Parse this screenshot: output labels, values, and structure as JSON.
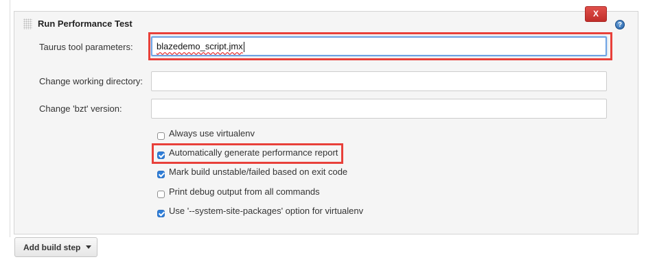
{
  "section": {
    "title": "Run Performance Test",
    "delete_label": "X",
    "help_label": "?"
  },
  "fields": [
    {
      "label": "Taurus tool parameters:",
      "value": "blazedemo_script.jmx"
    },
    {
      "label": "Change working directory:",
      "value": ""
    },
    {
      "label": "Change 'bzt' version:",
      "value": ""
    }
  ],
  "options": [
    {
      "label": "Always use virtualenv",
      "checked": false
    },
    {
      "label": "Automatically generate performance report",
      "checked": true
    },
    {
      "label": "Mark build unstable/failed based on exit code",
      "checked": true
    },
    {
      "label": "Print debug output from all commands",
      "checked": false
    },
    {
      "label": "Use '--system-site-packages' option for virtualenv",
      "checked": true
    }
  ],
  "footer": {
    "add_build_step_label": "Add build step"
  },
  "colors": {
    "highlight": "#e8403a",
    "checkbox_checked": "#2f7ed8",
    "delete_button": "#d9534f"
  }
}
